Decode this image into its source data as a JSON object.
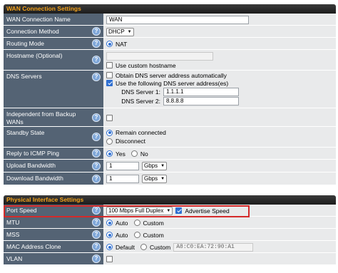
{
  "wan": {
    "header": "WAN Connection Settings",
    "name_label": "WAN Connection Name",
    "name_value": "WAN",
    "method_label": "Connection Method",
    "method_value": "DHCP",
    "routing_label": "Routing Mode",
    "routing_value": "NAT",
    "hostname_label": "Hostname (Optional)",
    "hostname_value": "",
    "hostname_check": "Use custom hostname",
    "dns_label": "DNS Servers",
    "dns_auto": "Obtain DNS server address automatically",
    "dns_manual": "Use the following DNS server address(es)",
    "dns1_label": "DNS Server 1:",
    "dns1_value": "1.1.1.1",
    "dns2_label": "DNS Server 2:",
    "dns2_value": "8.8.8.8",
    "independent_label": "Independent from Backup WANs",
    "standby_label": "Standby State",
    "standby_connected": "Remain connected",
    "standby_disconnect": "Disconnect",
    "icmp_label": "Reply to ICMP Ping",
    "icmp_yes": "Yes",
    "icmp_no": "No",
    "upload_label": "Upload Bandwidth",
    "upload_value": "1",
    "upload_unit": "Gbps",
    "download_label": "Download Bandwidth",
    "download_value": "1",
    "download_unit": "Gbps"
  },
  "phys": {
    "header": "Physical Interface Settings",
    "port_label": "Port Speed",
    "port_value": "100 Mbps Full Duplex",
    "advertise": "Advertise Speed",
    "mtu_label": "MTU",
    "mtu_auto": "Auto",
    "mtu_custom": "Custom",
    "mss_label": "MSS",
    "mss_auto": "Auto",
    "mss_custom": "Custom",
    "mac_label": "MAC Address Clone",
    "mac_default": "Default",
    "mac_custom": "Custom",
    "mac_value": "A8:C0:EA:72:90:A1",
    "vlan_label": "VLAN"
  },
  "help_glyph": "?",
  "caret_glyph": "▼",
  "colors": {
    "header_text": "#f4a21b",
    "label_bg": "#546374",
    "value_bg": "#e9eaeb",
    "highlight": "#d42a2a",
    "accent": "#2f6fd1"
  }
}
